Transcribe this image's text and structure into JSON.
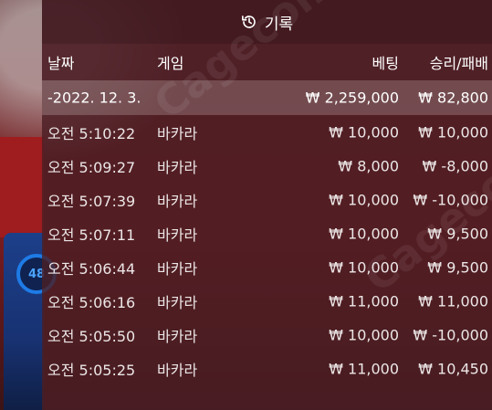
{
  "header": {
    "title": "기록"
  },
  "side": {
    "gauge_label": "48"
  },
  "columns": {
    "date": "날짜",
    "game": "게임",
    "bet": "베팅",
    "result": "승리/패배"
  },
  "date_row": {
    "date": "-2022. 12. 3.",
    "bet": "₩ 2,259,000",
    "result": "₩ 82,800"
  },
  "rows": [
    {
      "time": "오전 5:10:22",
      "game": "바카라",
      "bet": "₩ 10,000",
      "result": "₩ 10,000"
    },
    {
      "time": "오전 5:09:27",
      "game": "바카라",
      "bet": "₩ 8,000",
      "result": "₩ -8,000"
    },
    {
      "time": "오전 5:07:39",
      "game": "바카라",
      "bet": "₩ 10,000",
      "result": "₩ -10,000"
    },
    {
      "time": "오전 5:07:11",
      "game": "바카라",
      "bet": "₩ 10,000",
      "result": "₩ 9,500"
    },
    {
      "time": "오전 5:06:44",
      "game": "바카라",
      "bet": "₩ 10,000",
      "result": "₩ 9,500"
    },
    {
      "time": "오전 5:06:16",
      "game": "바카라",
      "bet": "₩ 11,000",
      "result": "₩ 11,000"
    },
    {
      "time": "오전 5:05:50",
      "game": "바카라",
      "bet": "₩ 10,000",
      "result": "₩ -10,000"
    },
    {
      "time": "오전 5:05:25",
      "game": "바카라",
      "bet": "₩ 11,000",
      "result": "₩ 10,450"
    }
  ],
  "watermark_text": "Cagecom"
}
